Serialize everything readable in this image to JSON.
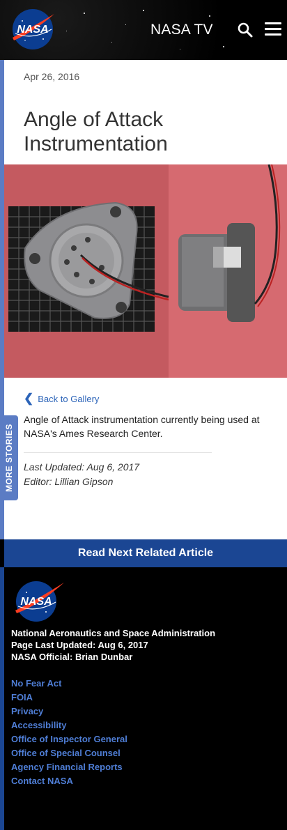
{
  "header": {
    "logo_text": "NASA",
    "tv_label": "NASA TV",
    "search_icon": "search-icon",
    "menu_icon": "hamburger-menu-icon"
  },
  "article": {
    "date": "Apr 26, 2016",
    "title": "Angle of Attack Instrumentation",
    "back_link": "Back to Gallery",
    "caption": "Angle of Attack instrumentation currently being used at NASA's Ames Research Center.",
    "last_updated": "Last Updated: Aug 6, 2017",
    "editor": "Editor: Lillian Gipson"
  },
  "side_tab": {
    "label": "MORE STORIES"
  },
  "read_next": {
    "label": "Read Next Related Article"
  },
  "footer": {
    "logo_text": "NASA",
    "org_name": "National Aeronautics and Space Administration",
    "page_updated": "Page Last Updated: Aug 6, 2017",
    "official": "NASA Official: Brian Dunbar",
    "links": [
      "No Fear Act",
      "FOIA",
      "Privacy",
      "Accessibility",
      "Office of Inspector General",
      "Office of Special Counsel",
      "Agency Financial Reports",
      "Contact NASA"
    ]
  },
  "colors": {
    "accent_blue": "#1b4693",
    "side_blue": "#5b7cc4",
    "link_blue": "#4f7ed6"
  }
}
